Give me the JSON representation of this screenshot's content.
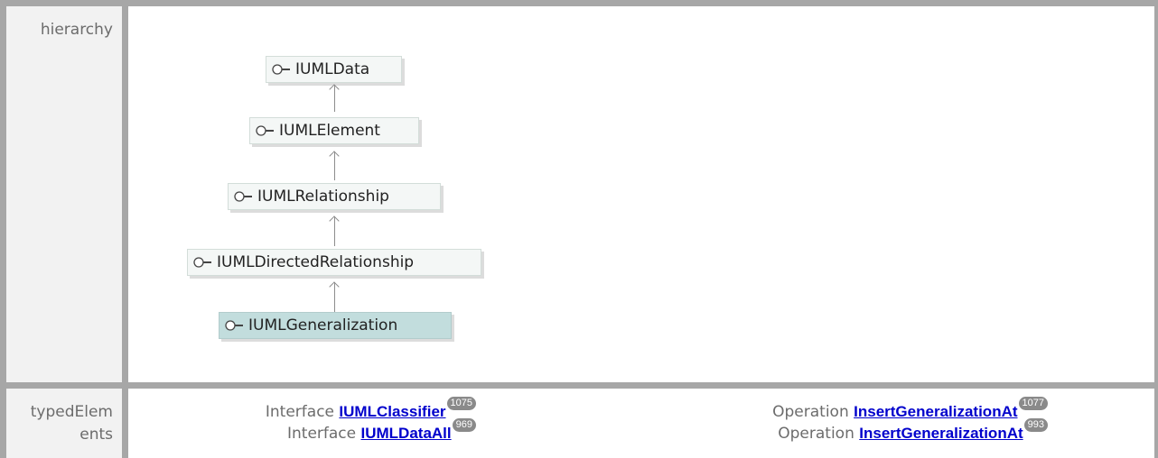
{
  "rows": {
    "hierarchy_label": "hierarchy",
    "typed_label_line1": "typedElem",
    "typed_label_line2": "ents"
  },
  "hierarchy": [
    {
      "name": "IUMLData",
      "selected": false
    },
    {
      "name": "IUMLElement",
      "selected": false
    },
    {
      "name": "IUMLRelationship",
      "selected": false
    },
    {
      "name": "IUMLDirectedRelationship",
      "selected": false
    },
    {
      "name": "IUMLGeneralization",
      "selected": true
    }
  ],
  "typed_elements": {
    "left": [
      {
        "kind": "Interface",
        "name": "IUMLClassifier",
        "count": "1075"
      },
      {
        "kind": "Interface",
        "name": "IUMLDataAll",
        "count": "969"
      }
    ],
    "right": [
      {
        "kind": "Operation",
        "name": "InsertGeneralizationAt",
        "count": "1077"
      },
      {
        "kind": "Operation",
        "name": "InsertGeneralizationAt",
        "count": "993"
      }
    ]
  },
  "colors": {
    "frame": "#a7a7a7",
    "label_bg": "#f2f2f2",
    "link": "#0000cc",
    "selected_node": "#c2dddd",
    "badge": "#8a8a8a"
  },
  "icons": {
    "interface": "interface-lollipop-icon"
  }
}
